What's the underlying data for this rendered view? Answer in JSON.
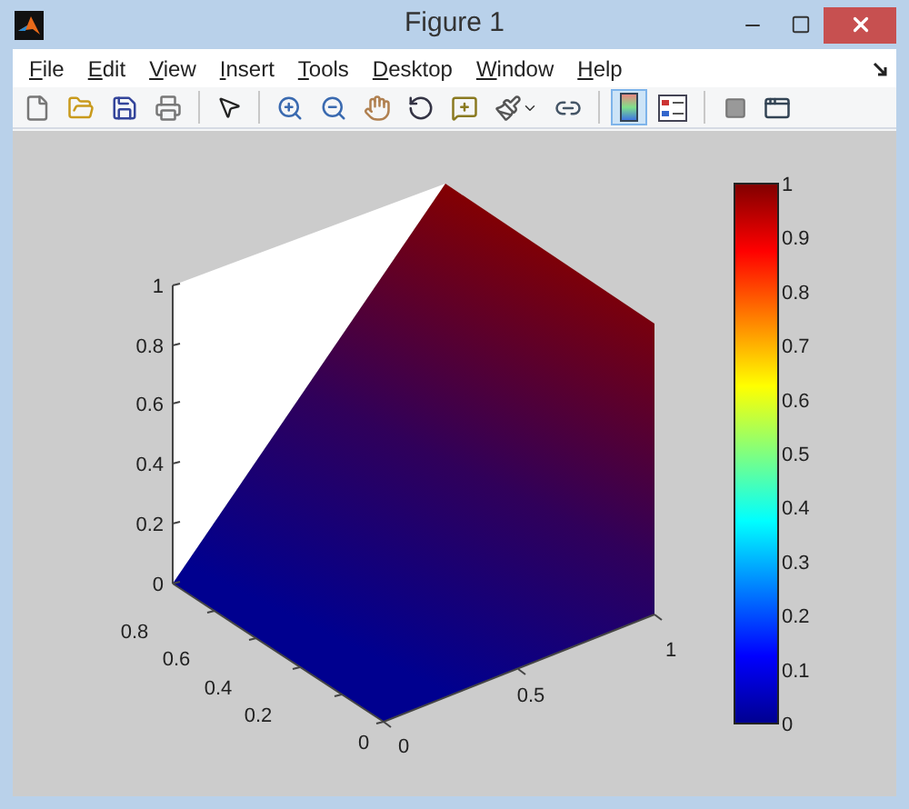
{
  "window": {
    "title": "Figure 1"
  },
  "menu": [
    {
      "label": "File"
    },
    {
      "label": "Edit"
    },
    {
      "label": "View"
    },
    {
      "label": "Insert"
    },
    {
      "label": "Tools"
    },
    {
      "label": "Desktop"
    },
    {
      "label": "Window"
    },
    {
      "label": "Help"
    }
  ],
  "toolbar": {
    "items": [
      {
        "selected": false
      },
      {
        "selected": false
      },
      {
        "selected": false
      },
      {
        "selected": false
      },
      {
        "selected": false
      },
      {
        "selected": false
      },
      {
        "selected": false
      },
      {
        "selected": false
      },
      {
        "selected": false
      },
      {
        "selected": false
      },
      {
        "selected": false
      },
      {
        "selected": false
      },
      {
        "selected": true
      },
      {
        "selected": false
      },
      {
        "selected": false
      },
      {
        "selected": false
      }
    ]
  },
  "axes": {
    "z_ticks": [
      "1",
      "0.8",
      "0.6",
      "0.4",
      "0.2",
      "0"
    ],
    "y_ticks": [
      "0",
      "0.2",
      "0.4",
      "0.6",
      "0.8"
    ],
    "x_ticks": [
      "0",
      "0.5",
      "1"
    ]
  },
  "colorbar": {
    "ticks": [
      "1",
      "0.9",
      "0.8",
      "0.7",
      "0.6",
      "0.5",
      "0.4",
      "0.3",
      "0.2",
      "0.1",
      "0"
    ]
  }
}
